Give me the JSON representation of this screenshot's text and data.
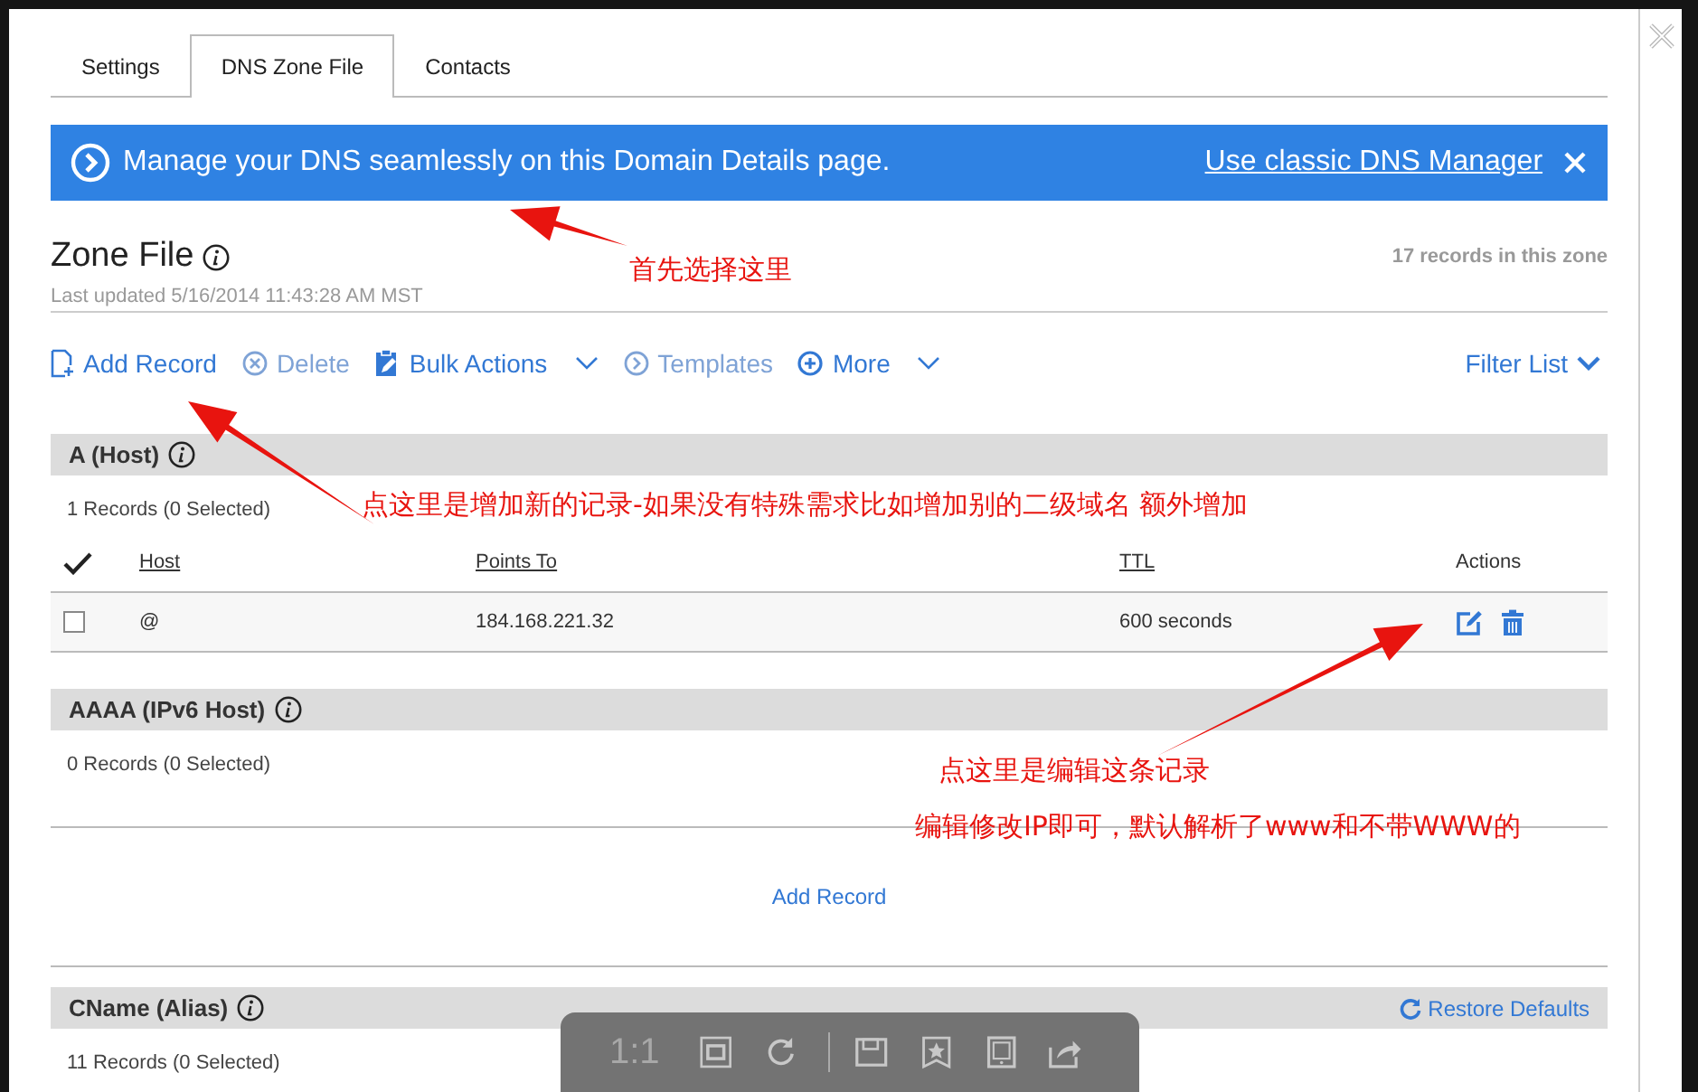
{
  "tabs": [
    {
      "label": "Settings",
      "selected": false
    },
    {
      "label": "DNS Zone File",
      "selected": true
    },
    {
      "label": "Contacts",
      "selected": false
    }
  ],
  "banner": {
    "message": "Manage your DNS seamlessly on this Domain Details page.",
    "link": "Use classic DNS Manager"
  },
  "zone": {
    "title": "Zone File",
    "updated": "Last updated 5/16/2014 11:43:28 AM MST",
    "count": "17 records in this zone"
  },
  "toolbar": [
    {
      "label": "Add Record",
      "kind": "add",
      "disabled": false,
      "menu": false
    },
    {
      "label": "Delete",
      "kind": "delete",
      "disabled": true,
      "menu": false
    },
    {
      "label": "Bulk Actions",
      "kind": "bulk",
      "disabled": false,
      "menu": true
    },
    {
      "label": "Templates",
      "kind": "templates",
      "disabled": true,
      "menu": false
    },
    {
      "label": "More",
      "kind": "more",
      "disabled": false,
      "menu": true
    }
  ],
  "filter": {
    "label": "Filter List"
  },
  "sections": [
    {
      "title": "A (Host)",
      "summary": "1 Records (0 Selected)",
      "columns": [
        "Host",
        "Points To",
        "TTL",
        "Actions"
      ],
      "rows": [
        {
          "checked": false,
          "host": "@",
          "points_to": "184.168.221.32",
          "ttl": "600 seconds"
        }
      ]
    },
    {
      "title": "AAAA (IPv6 Host)",
      "summary": "0 Records (0 Selected)",
      "empty_action": "Add Record"
    },
    {
      "title": "CName (Alias)",
      "summary": "11 Records (0 Selected)",
      "header_action": "Restore Defaults"
    }
  ],
  "annotations": [
    {
      "text": "首先选择这里",
      "arrow": true
    },
    {
      "text": "点这里是增加新的记录-如果没有特殊需求比如增加别的二级域名 额外增加",
      "arrow": true
    },
    {
      "text": "点这里是编辑这条记录",
      "arrow": true
    },
    {
      "text": "编辑修改IP即可，默认解析了www和不带WWW的"
    }
  ],
  "viewer_toolbar": {
    "zoom_label": "1:1"
  }
}
